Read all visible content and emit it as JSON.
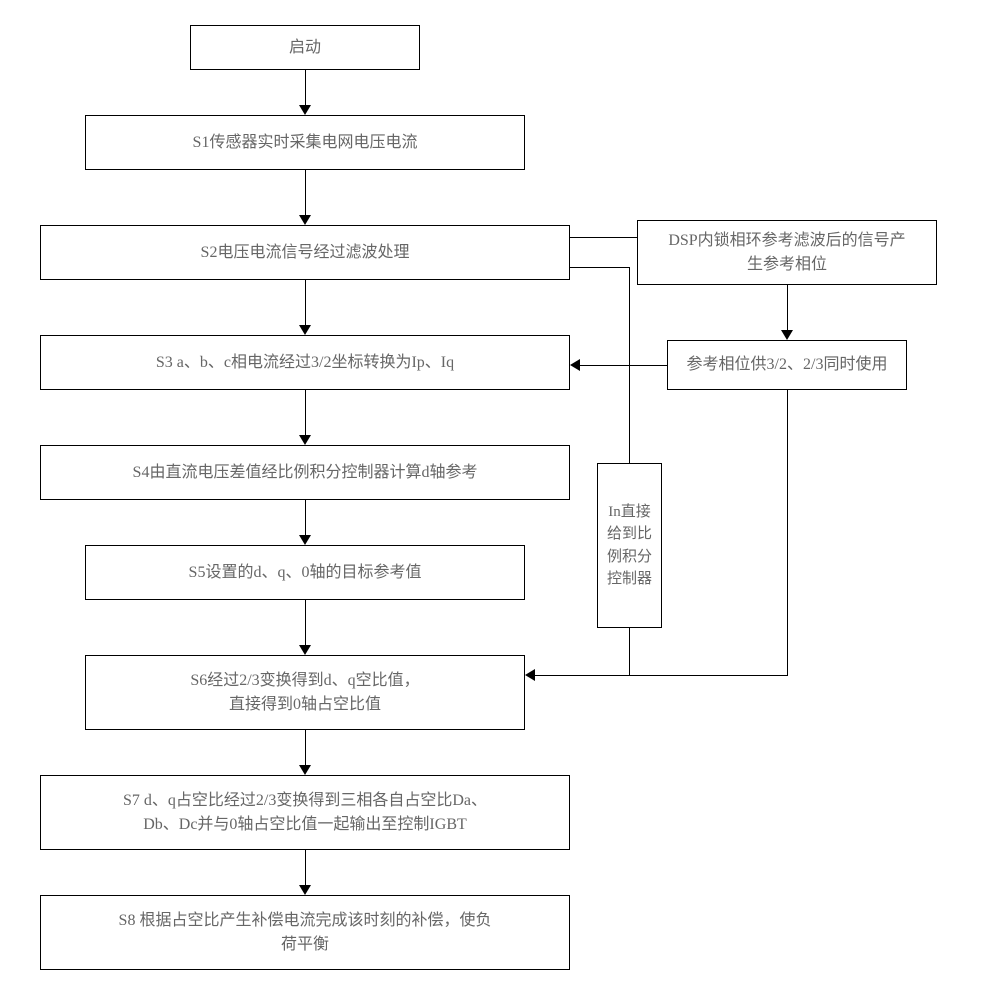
{
  "start": "启动",
  "s1": "S1传感器实时采集电网电压电流",
  "s2": "S2电压电流信号经过滤波处理",
  "s3": "S3 a、b、c相电流经过3/2坐标转换为Ip、Iq",
  "s4": "S4由直流电压差值经比例积分控制器计算d轴参考",
  "s5": "S5设置的d、q、0轴的目标参考值",
  "s6": "S6经过2/3变换得到d、q空比值，\n直接得到0轴占空比值",
  "s7": "S7 d、q占空比经过2/3变换得到三相各自占空比Da、\nDb、Dc并与0轴占空比值一起输出至控制IGBT",
  "s8": "S8 根据占空比产生补偿电流完成该时刻的补偿，使负\n荷平衡",
  "dsp": "DSP内锁相环参考滤波后的信号产\n生参考相位",
  "ref": "参考相位供3/2、2/3同时使用",
  "in_ctrl": "In直接\n给到比\n例积分\n控制器"
}
